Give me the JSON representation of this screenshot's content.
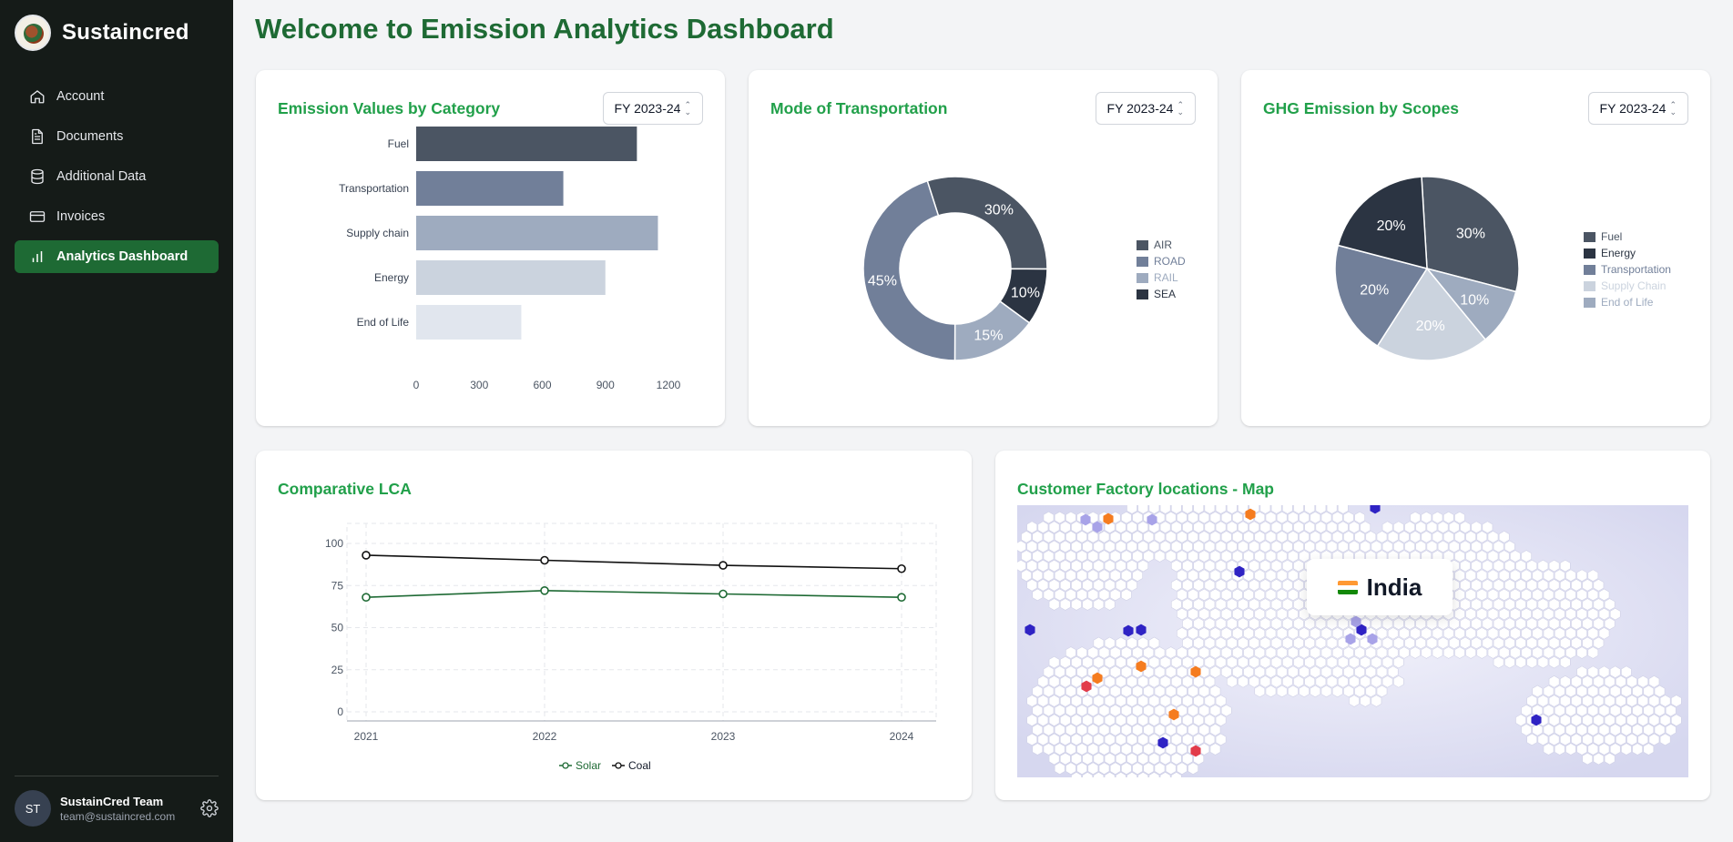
{
  "brand": {
    "name": "Sustaincred"
  },
  "sidebar": {
    "items": [
      {
        "label": "Account",
        "icon": "home-icon"
      },
      {
        "label": "Documents",
        "icon": "document-icon"
      },
      {
        "label": "Additional Data",
        "icon": "database-icon"
      },
      {
        "label": "Invoices",
        "icon": "card-icon"
      },
      {
        "label": "Analytics Dashboard",
        "icon": "bar-chart-icon",
        "active": true
      }
    ]
  },
  "user": {
    "initials": "ST",
    "name": "SustainCred Team",
    "email": "team@sustaincred.com"
  },
  "page": {
    "title": "Welcome to Emission Analytics Dashboard"
  },
  "colors": {
    "accent": "#1e6a34",
    "title_green": "#21a04a",
    "sidebar_bg": "#151b18"
  },
  "cards": {
    "emission": {
      "title": "Emission Values by Category",
      "fy": "FY 2023-24"
    },
    "transport": {
      "title": "Mode of Transportation",
      "fy": "FY 2023-24"
    },
    "ghg": {
      "title": "GHG Emission by Scopes",
      "fy": "FY 2023-24"
    },
    "lca": {
      "title": "Comparative LCA"
    },
    "map": {
      "title": "Customer Factory locations - Map",
      "country": "India"
    }
  },
  "chart_data": [
    {
      "type": "bar",
      "orientation": "horizontal",
      "categories": [
        "Fuel",
        "Transportation",
        "Supply chain",
        "Energy",
        "End of Life"
      ],
      "values": [
        1050,
        700,
        1150,
        900,
        500
      ],
      "colors": [
        "#4b5563",
        "#717f99",
        "#9eabbf",
        "#cbd3de",
        "#e1e6ee"
      ],
      "xticks": [
        0,
        300,
        600,
        900,
        1200
      ],
      "xlim": [
        0,
        1200
      ]
    },
    {
      "type": "pie",
      "donut": true,
      "labels": [
        "AIR",
        "ROAD",
        "RAIL",
        "SEA"
      ],
      "values": [
        30,
        45,
        15,
        10
      ],
      "colors": [
        "#4b5563",
        "#717f99",
        "#9eabbf",
        "#2b3442"
      ],
      "legend_text_colors": [
        "#4b5563",
        "#717f99",
        "#9eabbf",
        "#2b3442"
      ],
      "legend": "right"
    },
    {
      "type": "pie",
      "labels": [
        "Fuel",
        "Energy",
        "Transportation",
        "Supply Chain",
        "End of Life"
      ],
      "values": [
        30,
        20,
        20,
        20,
        10
      ],
      "colors": [
        "#4b5563",
        "#2b3442",
        "#717f99",
        "#cbd3de",
        "#9eabbf"
      ],
      "legend_text_colors": [
        "#4b5563",
        "#2b3442",
        "#717f99",
        "#cbd3de",
        "#9eabbf"
      ],
      "legend": "right"
    },
    {
      "type": "line",
      "x": [
        "2021",
        "2022",
        "2023",
        "2024"
      ],
      "series": [
        {
          "name": "Solar",
          "values": [
            68,
            72,
            70,
            68
          ],
          "color": "#1e6a34"
        },
        {
          "name": "Coal",
          "values": [
            93,
            90,
            87,
            85
          ],
          "color": "#111111"
        }
      ],
      "yticks": [
        0,
        25,
        50,
        75,
        100
      ],
      "ylim": [
        0,
        100
      ],
      "grid": true,
      "legend": "bottom"
    }
  ]
}
